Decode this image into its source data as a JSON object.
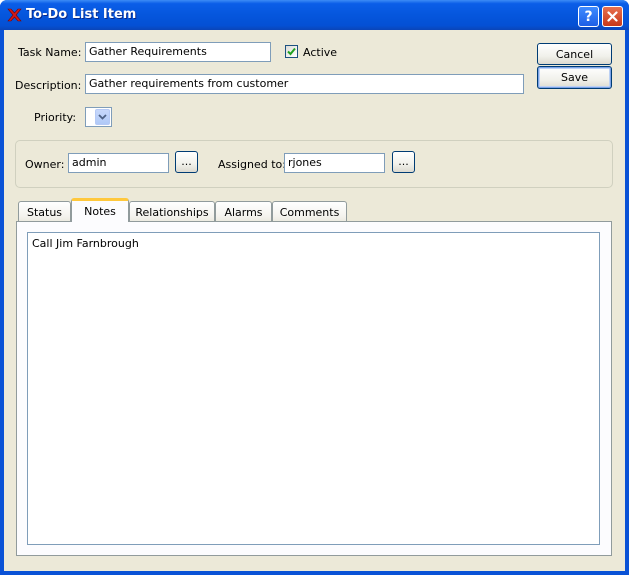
{
  "window": {
    "title": "To-Do List Item",
    "help_label": "?",
    "app_icon": "x-logo-icon"
  },
  "form": {
    "task_name_label": "Task Name:",
    "task_name_value": "Gather Requirements",
    "active_label": "Active",
    "active_checked": true,
    "description_label": "Description:",
    "description_value": "Gather requirements from customer",
    "priority_label": "Priority:",
    "priority_value": ""
  },
  "buttons": {
    "cancel": "Cancel",
    "save": "Save"
  },
  "assignment": {
    "owner_label": "Owner:",
    "owner_value": "admin",
    "owner_lookup": "...",
    "assigned_label": "Assigned to:",
    "assigned_value": "rjones",
    "assigned_lookup": "..."
  },
  "tabs": [
    {
      "label": "Status",
      "active": false
    },
    {
      "label": "Notes",
      "active": true
    },
    {
      "label": "Relationships",
      "active": false
    },
    {
      "label": "Alarms",
      "active": false
    },
    {
      "label": "Comments",
      "active": false
    }
  ],
  "notes": {
    "text": "Call Jim Farnbrough"
  },
  "colors": {
    "titlebar": "#0556dd",
    "client_bg": "#ece9d8",
    "active_tab_accent": "#ffc83c",
    "check_mark": "#21a121"
  }
}
